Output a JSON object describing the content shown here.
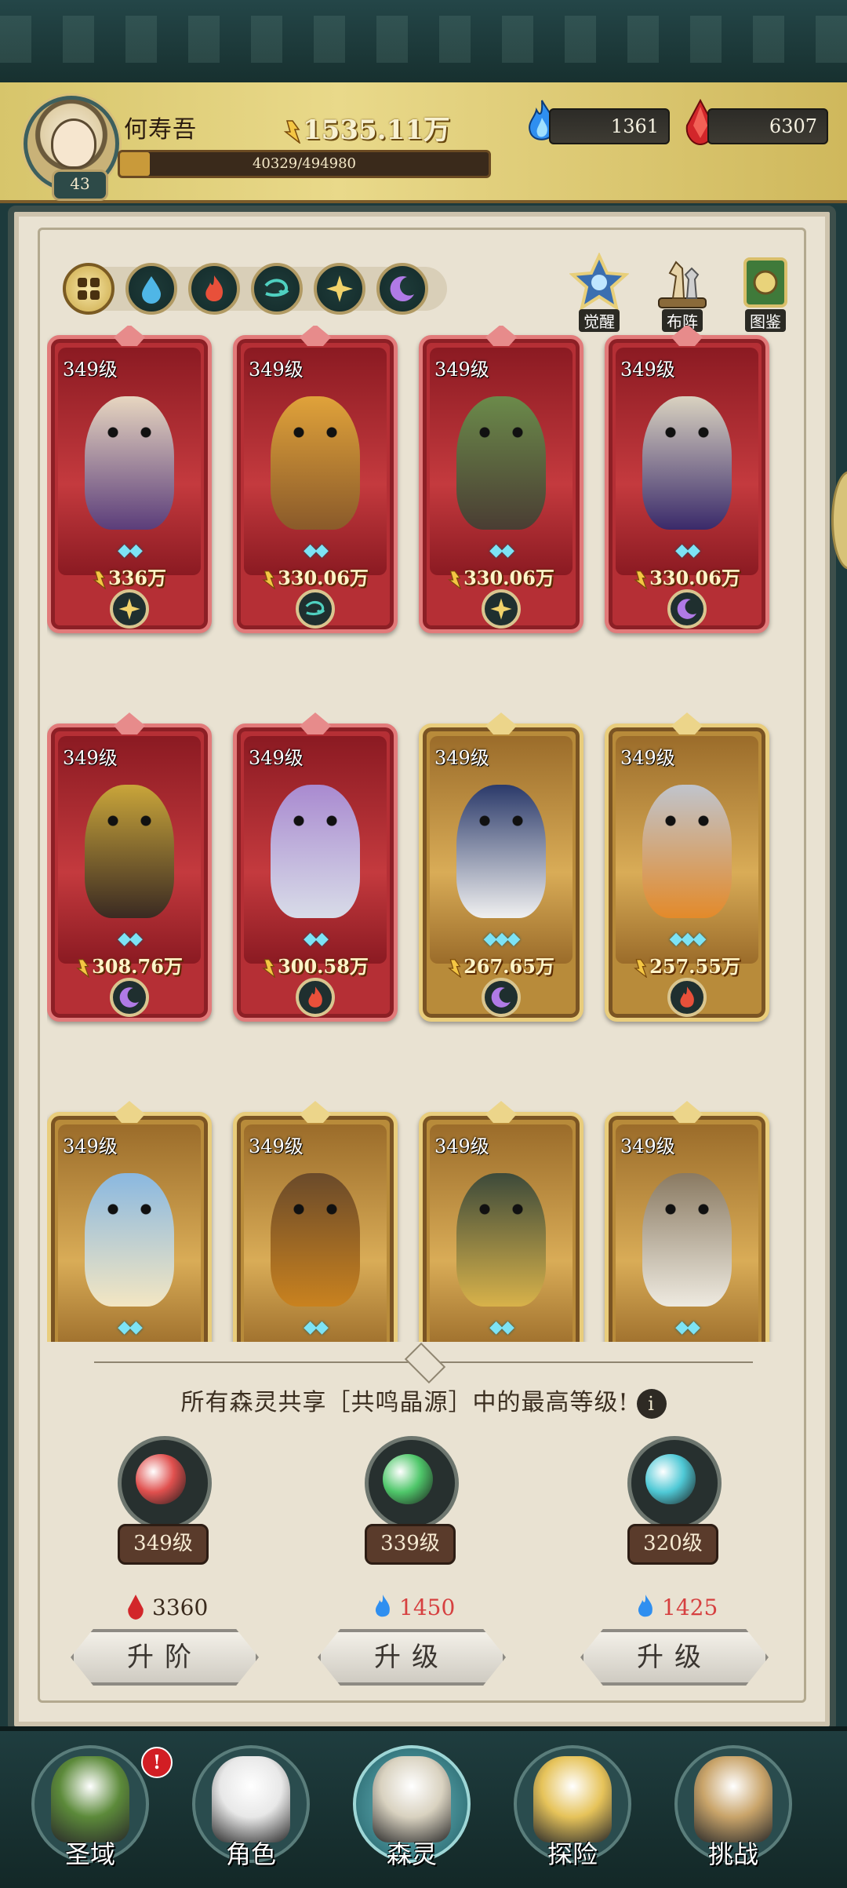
{
  "player": {
    "name": "何寿吾",
    "level": "43",
    "xp_text": "40329/494980",
    "xp_fraction": 0.0815,
    "gold": "1535.11万"
  },
  "resources": {
    "blue_flame": "1361",
    "red_crystal": "6307"
  },
  "filters": [
    {
      "name": "all",
      "icon": "clover-icon",
      "active": true
    },
    {
      "name": "water",
      "icon": "water-drop-icon",
      "active": false
    },
    {
      "name": "fire",
      "icon": "fire-icon",
      "active": false
    },
    {
      "name": "wind",
      "icon": "wind-swirl-icon",
      "active": false
    },
    {
      "name": "light",
      "icon": "light-star-icon",
      "active": false
    },
    {
      "name": "dark",
      "icon": "moon-icon",
      "active": false
    }
  ],
  "side_buttons": {
    "awaken": "觉醒",
    "formation": "布阵",
    "codex": "图鉴"
  },
  "cards": [
    {
      "level": "349级",
      "power": "336万",
      "stars": "◆◆",
      "frame": "red",
      "element": "light",
      "colors": [
        "#5b3d7a",
        "#e7d6c0"
      ]
    },
    {
      "level": "349级",
      "power": "330.06万",
      "stars": "◆◆",
      "frame": "red",
      "element": "wind",
      "colors": [
        "#8a5a2a",
        "#e0a23a"
      ]
    },
    {
      "level": "349级",
      "power": "330.06万",
      "stars": "◆◆",
      "frame": "red",
      "element": "light",
      "colors": [
        "#4a3d33",
        "#6b8a4a"
      ]
    },
    {
      "level": "349级",
      "power": "330.06万",
      "stars": "◆◆",
      "frame": "red",
      "element": "dark",
      "colors": [
        "#3a2a6a",
        "#d9d2c0"
      ]
    },
    {
      "level": "349级",
      "power": "308.76万",
      "stars": "◆◆",
      "frame": "red",
      "element": "dark",
      "colors": [
        "#3a2a22",
        "#c9a53a"
      ]
    },
    {
      "level": "349级",
      "power": "300.58万",
      "stars": "◆◆",
      "frame": "red",
      "element": "fire",
      "colors": [
        "#d8dce8",
        "#a98ad0"
      ]
    },
    {
      "level": "349级",
      "power": "267.65万",
      "stars": "◆◆◆",
      "frame": "gold",
      "element": "dark",
      "colors": [
        "#f0f0f0",
        "#2b3a6a"
      ]
    },
    {
      "level": "349级",
      "power": "257.55万",
      "stars": "◆◆◆",
      "frame": "gold",
      "element": "fire",
      "colors": [
        "#e38a2a",
        "#c0c4cc"
      ]
    },
    {
      "level": "349级",
      "power": "",
      "stars": "◆◆",
      "frame": "gold",
      "element": "water",
      "colors": [
        "#f3e6c2",
        "#8ab8e0"
      ]
    },
    {
      "level": "349级",
      "power": "",
      "stars": "◆◆",
      "frame": "gold",
      "element": "wind",
      "colors": [
        "#c9821f",
        "#6a4a2a"
      ]
    },
    {
      "level": "349级",
      "power": "",
      "stars": "◆◆",
      "frame": "gold",
      "element": "light",
      "colors": [
        "#d8b24a",
        "#3d4a3a"
      ]
    },
    {
      "level": "349级",
      "power": "",
      "stars": "◆◆",
      "frame": "gold",
      "element": "light",
      "colors": [
        "#eeeae0",
        "#8a7a62"
      ]
    }
  ],
  "resonance": {
    "note": "所有森灵共享［共鸣晶源］中的最高等级!",
    "crystals": [
      {
        "level": "349级",
        "orb": "#e0504e",
        "cost": "3360",
        "cost_color": "#3a2a1c",
        "cost_icon": "red-crystal-icon",
        "button": "升阶"
      },
      {
        "level": "339级",
        "orb": "#4fc76a",
        "cost": "1450",
        "cost_color": "#d64040",
        "cost_icon": "blue-flame-icon",
        "button": "升级"
      },
      {
        "level": "320级",
        "orb": "#4fc9d6",
        "cost": "1425",
        "cost_color": "#d64040",
        "cost_icon": "blue-flame-icon",
        "button": "升级"
      }
    ]
  },
  "nav": [
    {
      "label": "圣域",
      "active": false,
      "badge": "!",
      "art": "#5c8a3a"
    },
    {
      "label": "角色",
      "active": false,
      "badge": "",
      "art": "#e8e8e8"
    },
    {
      "label": "森灵",
      "active": true,
      "badge": "",
      "art": "#d9d2c0"
    },
    {
      "label": "探险",
      "active": false,
      "badge": "",
      "art": "#e6c35a"
    },
    {
      "label": "挑战",
      "active": false,
      "badge": "",
      "art": "#c9a46a"
    }
  ]
}
